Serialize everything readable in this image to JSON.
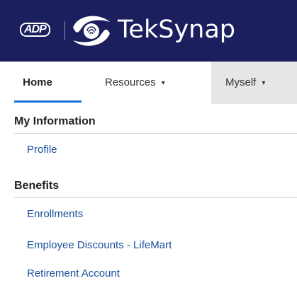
{
  "header": {
    "adp_logo_text": "ADP",
    "brand_name": "TekSynap",
    "colors": {
      "background": "#1b1f5e",
      "text": "#ffffff"
    }
  },
  "nav": {
    "tabs": [
      {
        "label": "Home",
        "active": true
      },
      {
        "label": "Resources",
        "caret": "▾"
      },
      {
        "label": "Myself",
        "caret": "▾"
      }
    ],
    "active_color": "#1d72d6"
  },
  "sections": [
    {
      "title": "My Information",
      "links": [
        "Profile"
      ]
    },
    {
      "title": "Benefits",
      "links": [
        "Enrollments",
        "Employee Discounts - LifeMart",
        "Retirement Account"
      ]
    }
  ],
  "link_color": "#1a4e9c"
}
